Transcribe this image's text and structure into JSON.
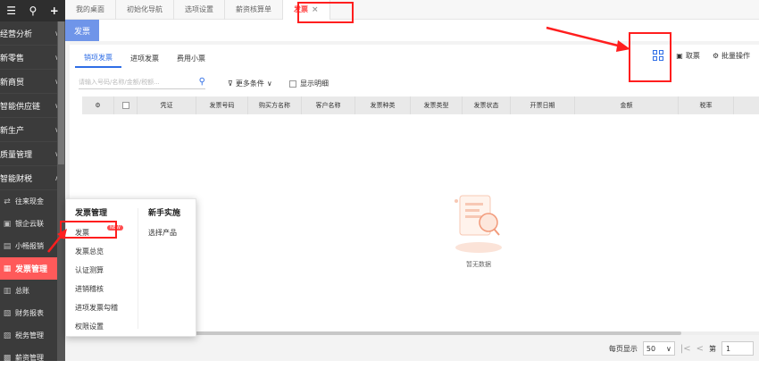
{
  "sidebar": {
    "top_icons": [
      "☰",
      "🔍",
      "+"
    ],
    "items": [
      {
        "label": "经营分析",
        "chevron": "∨"
      },
      {
        "label": "新零售",
        "chevron": "∨"
      },
      {
        "label": "新商贸",
        "chevron": "∨"
      },
      {
        "label": "智能供应链",
        "chevron": "∨"
      },
      {
        "label": "新生产",
        "chevron": "∨"
      },
      {
        "label": "质量管理",
        "chevron": "∨"
      },
      {
        "label": "智能财税",
        "chevron": "∧"
      }
    ],
    "subitems": [
      {
        "label": "往来现金",
        "icon": "⇄"
      },
      {
        "label": "银企云联",
        "icon": "▣"
      },
      {
        "label": "小畅报销",
        "icon": "▤"
      },
      {
        "label": "发票管理",
        "icon": "▦"
      },
      {
        "label": "总账",
        "icon": "▥"
      },
      {
        "label": "财务报表",
        "icon": "▧"
      },
      {
        "label": "税务管理",
        "icon": "▨"
      },
      {
        "label": "薪资管理",
        "icon": "▩"
      }
    ]
  },
  "topbar": {
    "tabs": [
      "我的桌面",
      "初始化导航",
      "选项设置",
      "薪资核算单"
    ],
    "active_tab": "发票",
    "close": "×"
  },
  "page": {
    "title": "发票",
    "subtabs": [
      "销项发票",
      "进项发票",
      "费用小票"
    ],
    "toolbar": {
      "qr_label": "",
      "fetch": "取票",
      "batch": "批量操作"
    },
    "search_placeholder": "请输入号码/名称/金额/税额...",
    "more_filters": "更多条件",
    "show_detail": "显示明细"
  },
  "table": {
    "columns": [
      "凭证",
      "发票号码",
      "购买方名称",
      "客户名称",
      "发票种类",
      "发票类型",
      "发票状态",
      "开票日期",
      "金额",
      "税率"
    ]
  },
  "empty": {
    "text": "暂无数据"
  },
  "pager": {
    "per_page_label": "每页显示",
    "per_page": "50",
    "page_label": "第",
    "page": "1"
  },
  "popup": {
    "col1_header": "发票管理",
    "col1_items": [
      "发票",
      "发票总览",
      "认证测算",
      "进销稽核",
      "进项发票勾稽",
      "权限设置"
    ],
    "badge": "NEW",
    "col2_header": "新手实施",
    "col2_items": [
      "选择产品"
    ]
  },
  "colors": {
    "accent": "#2f6ee6",
    "danger": "#ff1e1e",
    "sidebar": "#3b3b3b",
    "active_item": "#ff5a5a"
  }
}
